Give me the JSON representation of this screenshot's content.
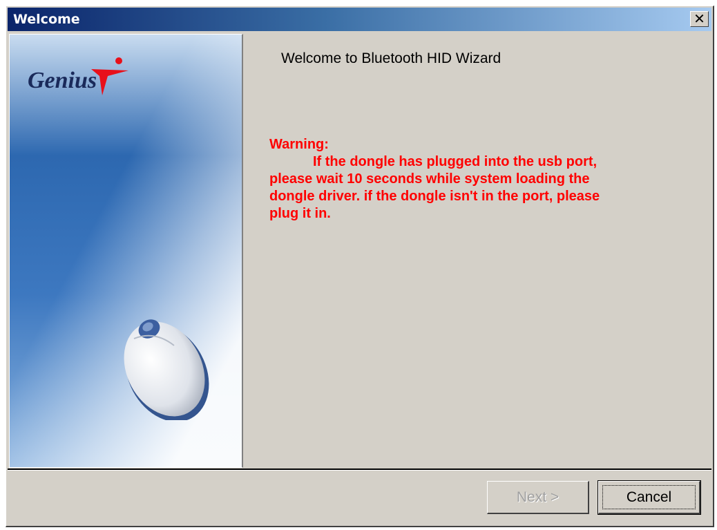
{
  "window": {
    "title": "Welcome"
  },
  "side_panel": {
    "logo_text": "Genius",
    "image": "computer-mouse"
  },
  "content": {
    "heading": "Welcome to Bluetooth HID Wizard",
    "warning": {
      "label": "Warning:",
      "line1": "If the dongle has plugged into the usb port,",
      "line2": "please wait 10 seconds while system loading the",
      "line3": "dongle driver. if the dongle isn't in the port, please",
      "line4": "plug it in."
    }
  },
  "buttons": {
    "next_label": "Next >",
    "next_enabled": false,
    "cancel_label": "Cancel"
  },
  "colors": {
    "warning_text": "#ff0000",
    "titlebar_start": "#0a246a",
    "titlebar_end": "#a6caf0",
    "dialog_face": "#d4d0c8",
    "logo_accent": "#e8101a"
  }
}
